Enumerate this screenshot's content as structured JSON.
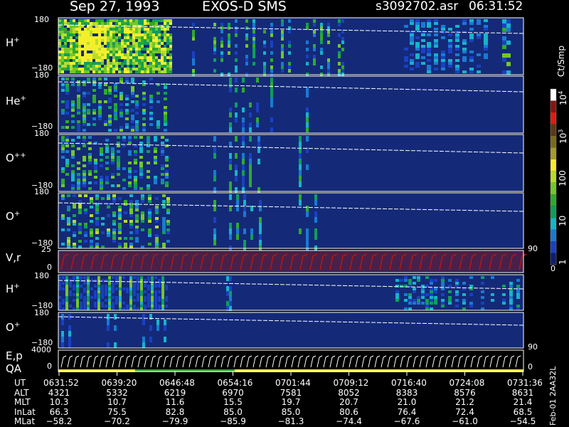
{
  "header": {
    "date": "Sep 27, 1993",
    "instrument": "EXOS-D SMS",
    "file": "s3092702.asr",
    "time": "06:31:52"
  },
  "panels": [
    {
      "id": "h-plus",
      "label": "H",
      "sup": "+",
      "ymax": "180",
      "ymin": "−180"
    },
    {
      "id": "he-plus",
      "label": "He",
      "sup": "+",
      "ymax": "180",
      "ymin": "−180"
    },
    {
      "id": "o-plusplus",
      "label": "O",
      "sup": "++",
      "ymax": "180",
      "ymin": "−180"
    },
    {
      "id": "o-plus",
      "label": "O",
      "sup": "+",
      "ymax": "180",
      "ymin": "−180"
    },
    {
      "id": "vr",
      "label": "V,r",
      "sup": "",
      "ymax": "25",
      "ymin": "0",
      "right_tick": "90"
    },
    {
      "id": "h-plus-2",
      "label": "H",
      "sup": "+",
      "ymax": "180",
      "ymin": "−180"
    },
    {
      "id": "o-plus-2",
      "label": "O",
      "sup": "+",
      "ymax": "180",
      "ymin": "−180",
      "right_tick": "90"
    },
    {
      "id": "ep-qa",
      "label": "E,p",
      "label2": "QA",
      "sup": "",
      "ymax": "4000",
      "ymin": "0",
      "right_tick": "0"
    }
  ],
  "colorbar": {
    "unit": "Ct/Smp",
    "tick_labels": [
      "1",
      "10",
      "100",
      "10",
      "10"
    ],
    "tick_sups": [
      "",
      "",
      "",
      "3",
      "4"
    ],
    "low_label": "0",
    "colors": [
      "#0d1f6e",
      "#1b40c2",
      "#1a7ad2",
      "#17b3c9",
      "#0f9e5c",
      "#2faa2c",
      "#74c72a",
      "#b8dc2c",
      "#f4ef2c",
      "#a89a2a",
      "#7c6a1e",
      "#5b3a16",
      "#e01b12",
      "#8a1410",
      "#ffffff"
    ]
  },
  "footer": {
    "rows": [
      {
        "label": "UT",
        "values": [
          "0631:52",
          "0639:20",
          "0646:48",
          "0654:16",
          "0701:44",
          "0709:12",
          "0716:40",
          "0724:08",
          "0731:36"
        ]
      },
      {
        "label": "ALT",
        "values": [
          "4321",
          "5332",
          "6219",
          "6970",
          "7581",
          "8052",
          "8383",
          "8576",
          "8631"
        ]
      },
      {
        "label": "MLT",
        "values": [
          "10.3",
          "10.7",
          "11.6",
          "15.5",
          "19.7",
          "20.7",
          "21.0",
          "21.2",
          "21.4"
        ]
      },
      {
        "label": "InLat",
        "values": [
          "66.3",
          "75.5",
          "82.8",
          "85.0",
          "85.0",
          "80.6",
          "76.4",
          "72.4",
          "68.5"
        ]
      },
      {
        "label": "MLat",
        "values": [
          "−58.2",
          "−70.2",
          "−79.9",
          "−85.9",
          "−81.3",
          "−74.4",
          "−67.6",
          "−61.0",
          "−54.5"
        ]
      }
    ],
    "side_note": "Feb-01 2AA32L"
  },
  "chart_data": {
    "type": "heatmap",
    "title": "Sep 27, 1993   EXOS-D SMS",
    "x_axis": "UT",
    "x_ticks": [
      "0631:52",
      "0639:20",
      "0646:48",
      "0654:16",
      "0701:44",
      "0709:12",
      "0716:40",
      "0724:08",
      "0731:36"
    ],
    "panels": [
      "H+",
      "He+",
      "O++",
      "O+",
      "V,r",
      "H+",
      "O+",
      "E,p / QA"
    ],
    "ylim_angle": [
      -180,
      180
    ],
    "colorbar": {
      "unit": "Ct/Smp",
      "scale": "log",
      "range": [
        1,
        10000
      ]
    }
  }
}
